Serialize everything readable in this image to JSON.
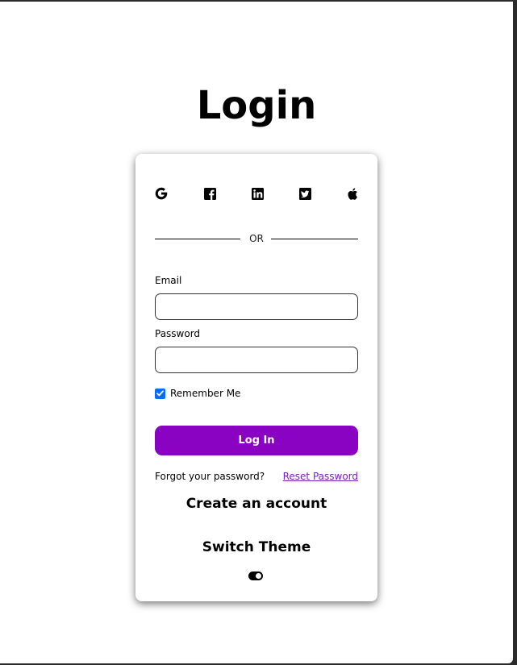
{
  "page": {
    "title": "Login"
  },
  "social": {
    "icons": [
      "google-icon",
      "facebook-icon",
      "linkedin-icon",
      "twitter-icon",
      "apple-icon"
    ]
  },
  "divider": {
    "text": "OR"
  },
  "form": {
    "email_label": "Email",
    "email_value": "",
    "password_label": "Password",
    "password_value": "",
    "remember_label": "Remember Me",
    "remember_checked": true,
    "login_label": "Log In"
  },
  "links": {
    "forgot_text": "Forgot your password?",
    "reset_label": "Reset Password",
    "create_account": "Create an account"
  },
  "theme": {
    "switch_label": "Switch Theme",
    "toggle_on": true
  },
  "colors": {
    "accent": "#8a02c2",
    "checkbox": "#0a6cff",
    "link": "#7a1fb8"
  }
}
